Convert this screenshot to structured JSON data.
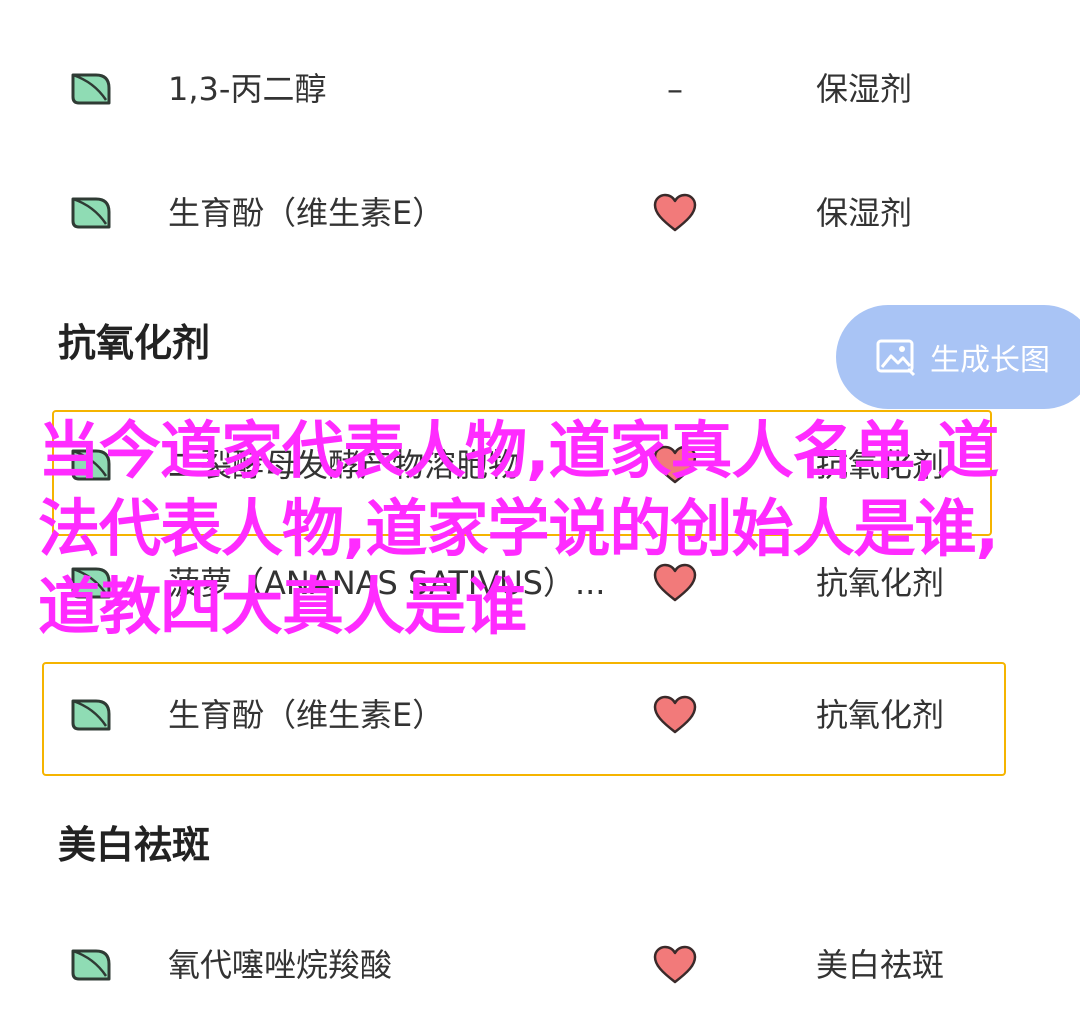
{
  "rows_top": [
    {
      "name": "1,3-丙二醇",
      "mid": "–",
      "func": "保湿剂",
      "favorite": false
    },
    {
      "name": "生育酚（维生素E）",
      "mid": "",
      "func": "保湿剂",
      "favorite": true
    }
  ],
  "section_antioxidant": {
    "title": "抗氧化剂"
  },
  "rows_antioxidant": [
    {
      "name": "二裂酵母发酵产物溶胞物",
      "func": "抗氧化剂",
      "favorite": true
    },
    {
      "name": "菠萝（ANANAS SATIVUS）...",
      "func": "抗氧化剂",
      "favorite": true
    },
    {
      "name": "生育酚（维生素E）",
      "func": "抗氧化剂",
      "favorite": true
    }
  ],
  "section_whitening": {
    "title": "美白祛斑"
  },
  "rows_whitening": [
    {
      "name": "氧代噻唑烷羧酸",
      "func": "美白祛斑",
      "favorite": true
    }
  ],
  "generate_button": {
    "label": "生成长图"
  },
  "overlay_text": "当今道家代表人物,道家真人名单,道法代表人物,道家学说的创始人是谁,道教四大真人是谁",
  "colors": {
    "leaf_fill": "#8fdcb4",
    "leaf_stroke": "#2f3b34",
    "heart": "#f27a7a",
    "highlight": "#f5b400",
    "overlay": "#ff2bff",
    "button": "#a9c4f5"
  }
}
